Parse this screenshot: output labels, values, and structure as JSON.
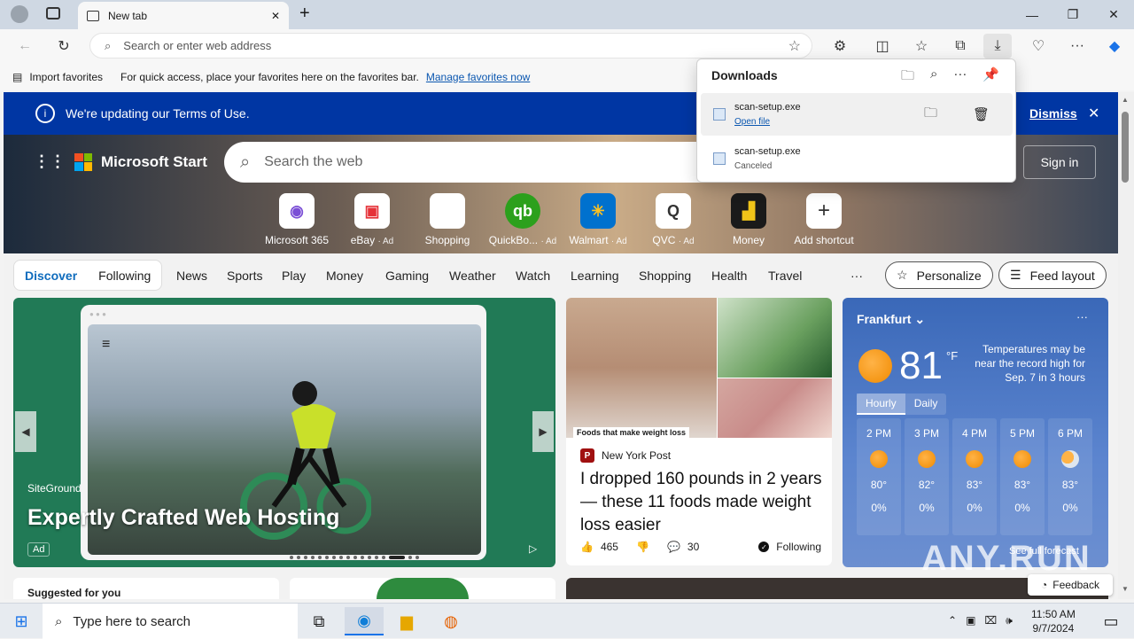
{
  "browser": {
    "tab_title": "New tab",
    "address_placeholder": "Search or enter web address",
    "favbar": {
      "import_label": "Import favorites",
      "hint": "For quick access, place your favorites here on the favorites bar.",
      "manage_link": "Manage favorites now"
    }
  },
  "downloads": {
    "title": "Downloads",
    "items": [
      {
        "name": "scan-setup.exe",
        "action": "Open file"
      },
      {
        "name": "scan-setup.exe",
        "status": "Canceled"
      }
    ]
  },
  "banner": {
    "text": "We're updating our Terms of Use.",
    "dismiss": "Dismiss"
  },
  "hero": {
    "brand": "Microsoft Start",
    "search_placeholder": "Search the web",
    "signin": "Sign in",
    "shortcuts": [
      {
        "label": "Microsoft 365",
        "ad": ""
      },
      {
        "label": "eBay",
        "ad": "· Ad"
      },
      {
        "label": "Shopping",
        "ad": ""
      },
      {
        "label": "QuickBo...",
        "ad": "· Ad"
      },
      {
        "label": "Walmart",
        "ad": "· Ad"
      },
      {
        "label": "QVC",
        "ad": "· Ad"
      },
      {
        "label": "Money",
        "ad": ""
      },
      {
        "label": "Add shortcut",
        "ad": ""
      }
    ]
  },
  "nav": {
    "discover": "Discover",
    "following": "Following",
    "items": [
      "News",
      "Sports",
      "Play",
      "Money",
      "Gaming",
      "Weather",
      "Watch",
      "Learning",
      "Shopping",
      "Health",
      "Travel"
    ],
    "more": "···",
    "personalize": "Personalize",
    "feed_layout": "Feed layout"
  },
  "ad_card": {
    "brand": "SiteGround",
    "title": "Expertly Crafted Web Hosting",
    "ad": "Ad"
  },
  "news_card": {
    "caption": "Foods that make weight loss",
    "source": "New York Post",
    "headline": "I dropped 160 pounds in 2 years — these 11 foods made weight loss easier",
    "likes": "465",
    "comments": "30",
    "following": "Following"
  },
  "weather": {
    "city": "Frankfurt",
    "temp": "81",
    "unit": "°F",
    "note": "Temperatures may be near the record high for Sep. 7 in 3 hours",
    "tabs": [
      "Hourly",
      "Daily"
    ],
    "hours": [
      {
        "time": "2 PM",
        "temp": "80°",
        "precip": "0%"
      },
      {
        "time": "3 PM",
        "temp": "82°",
        "precip": "0%"
      },
      {
        "time": "4 PM",
        "temp": "83°",
        "precip": "0%"
      },
      {
        "time": "5 PM",
        "temp": "83°",
        "precip": "0%"
      },
      {
        "time": "6 PM",
        "temp": "83°",
        "precip": "0%"
      }
    ],
    "full_forecast": "See full forecast"
  },
  "suggested": "Suggested for you",
  "feedback": "Feedback",
  "taskbar": {
    "search_placeholder": "Type here to search",
    "time": "11:50 AM",
    "date": "9/7/2024"
  },
  "watermark": "ANY.RUN"
}
